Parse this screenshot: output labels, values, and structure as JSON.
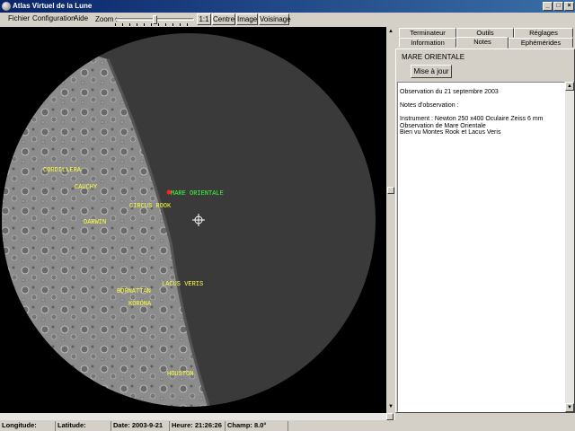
{
  "window": {
    "title": "Atlas Virtuel de la Lune"
  },
  "menu": {
    "items": [
      "Fichier",
      "Configuration",
      "Aide"
    ]
  },
  "toolbar": {
    "zoom_label": "Zoom :",
    "zoom_level": 0.5,
    "ratio_label": "1:1",
    "center_label": "Centre",
    "image_label": "Image",
    "neighborhood_label": "Voisinage"
  },
  "map": {
    "labels": [
      "MARE ORIENTALE",
      "CIRCUS ROOK",
      "LACUS VERIS",
      "KORONA",
      "CAUCHY",
      "DARWIN",
      "CORDILLERA",
      "HOUSTON",
      "BORNATTAN"
    ],
    "colors": {
      "feature_label": "#ffff40",
      "selected_label": "#40ff40",
      "marker": "#ff2020"
    }
  },
  "tabs": {
    "row_top": [
      "Terminateur",
      "Outils",
      "Réglages"
    ],
    "row_bottom": [
      "Information",
      "Notes",
      "Ephémérides"
    ],
    "active": "Notes"
  },
  "panel": {
    "feature_name": "MARE ORIENTALE",
    "update_button": "Mise à jour",
    "notes": [
      "Observation du 21 septembre 2003",
      "",
      "Notes d'observation :",
      "",
      "Instrument : Newton 250 x400 Oculaire Zeiss 6 mm",
      "Observation de Mare Orientale",
      "Bien vu Montes Rook et Lacus Veris"
    ]
  },
  "status": {
    "longitude": "Longitude:",
    "latitude": "Latitude:",
    "date": "Date:  2003-9-21",
    "time": "Heure:  21:26:26",
    "field": "Champ:  8.0°"
  }
}
